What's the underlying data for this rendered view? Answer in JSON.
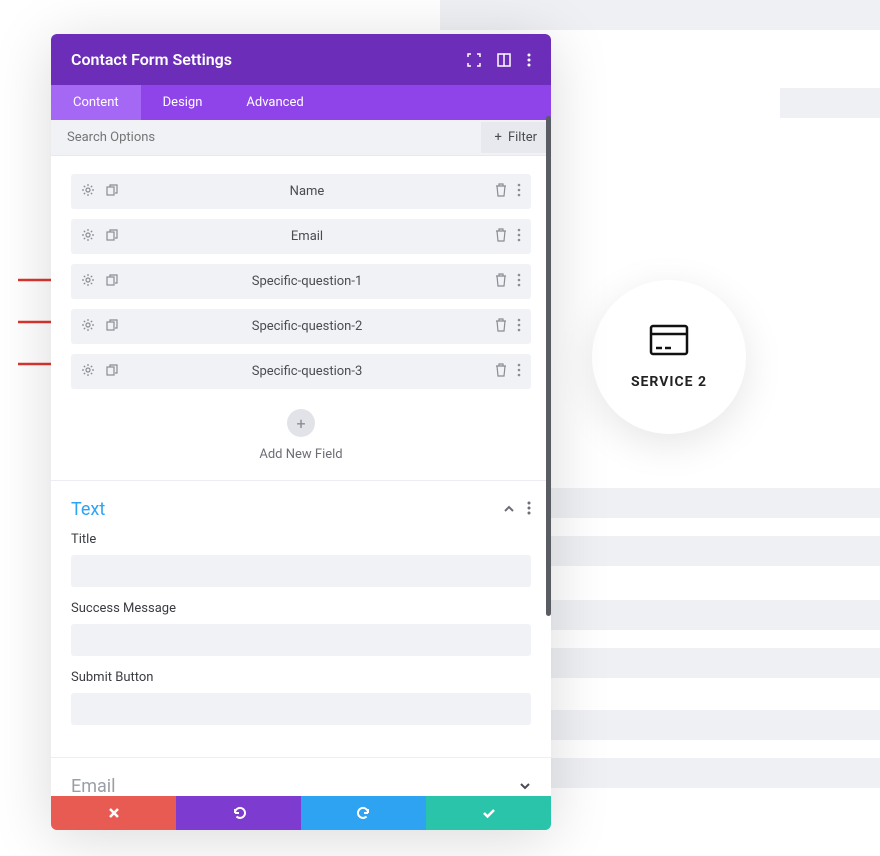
{
  "header": {
    "title": "Contact Form Settings"
  },
  "tabs": [
    {
      "label": "Content",
      "active": true
    },
    {
      "label": "Design",
      "active": false
    },
    {
      "label": "Advanced",
      "active": false
    }
  ],
  "search": {
    "placeholder": "Search Options",
    "filter_label": "Filter"
  },
  "fields": [
    {
      "label": "Name"
    },
    {
      "label": "Email"
    },
    {
      "label": "Specific-question-1"
    },
    {
      "label": "Specific-question-2"
    },
    {
      "label": "Specific-question-3"
    }
  ],
  "add_field_label": "Add New Field",
  "text_section": {
    "title": "Text",
    "groups": [
      {
        "label": "Title"
      },
      {
        "label": "Success Message"
      },
      {
        "label": "Submit Button"
      }
    ]
  },
  "email_section": {
    "title": "Email"
  },
  "service_circle": {
    "label": "SERVICE 2"
  },
  "arrow_positions": [
    274,
    316,
    358
  ],
  "bg_bars": [
    0,
    88,
    488,
    536,
    600,
    648,
    710,
    758
  ]
}
